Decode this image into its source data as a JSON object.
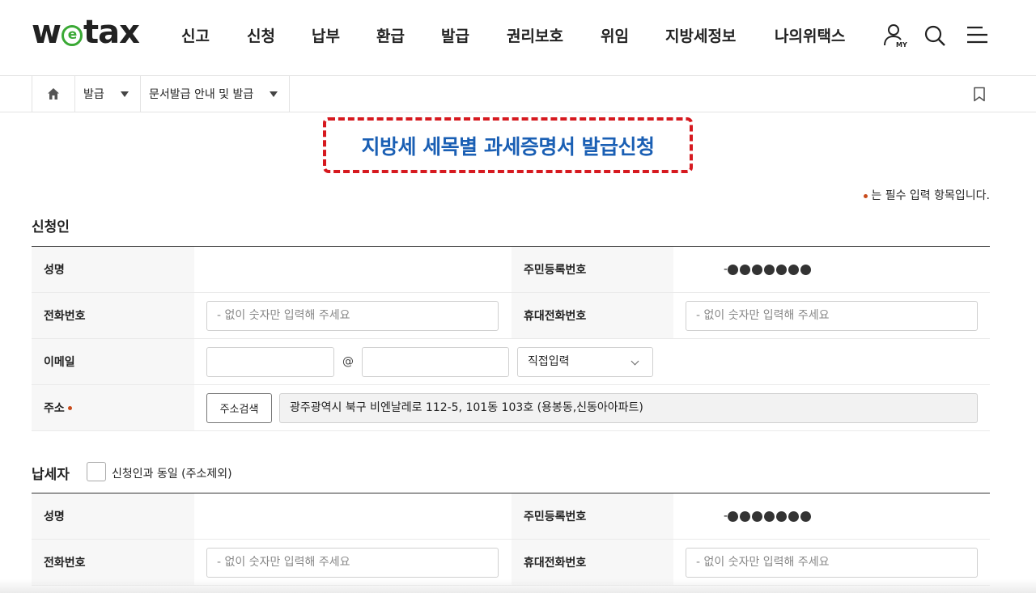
{
  "header": {
    "logo": {
      "pre": "w",
      "mid": "e",
      "post": "tax"
    },
    "nav": [
      "신고",
      "신청",
      "납부",
      "환급",
      "발급",
      "권리보호",
      "위임",
      "지방세정보",
      "나의위택스"
    ],
    "my_badge": "MY"
  },
  "breadcrumb": {
    "items": [
      "발급",
      "문서발급 안내 및 발급"
    ]
  },
  "page": {
    "title": "지방세 세목별 과세증명서 발급신청",
    "required_note": "는 필수 입력 항목입니다."
  },
  "applicant": {
    "section_title": "신청인",
    "name_label": "성명",
    "name_value": "",
    "rrn_label": "주민등록번호",
    "rrn_prefix": "-",
    "phone_label": "전화번호",
    "phone_placeholder": "- 없이 숫자만 입력해 주세요",
    "mobile_label": "휴대전화번호",
    "mobile_placeholder": "- 없이 숫자만 입력해 주세요",
    "email_label": "이메일",
    "email_at": "@",
    "email_domain_select": "직접입력",
    "address_label": "주소",
    "address_search_button": "주소검색",
    "address_value": "광주광역시 북구 비엔날레로 112-5, 101동 103호 (용봉동,신동아아파트)"
  },
  "taxpayer": {
    "section_title": "납세자",
    "same_as_label": "신청인과 동일 (주소제외)",
    "same_as_checked": false,
    "name_label": "성명",
    "name_value": "",
    "rrn_label": "주민등록번호",
    "rrn_prefix": "-",
    "phone_label": "전화번호",
    "phone_placeholder": "- 없이 숫자만 입력해 주세요",
    "mobile_label": "휴대전화번호",
    "mobile_placeholder": "- 없이 숫자만 입력해 주세요"
  },
  "colors": {
    "title_blue": "#1a5fb4",
    "dash_red": "#d6191f",
    "logo_green": "#3aa935",
    "required_dot": "#c84b1c"
  },
  "icons": [
    "user-my-icon",
    "search-icon",
    "menu-icon",
    "home-icon",
    "bookmark-icon",
    "dropdown-triangle-icon",
    "chevron-down-icon"
  ]
}
